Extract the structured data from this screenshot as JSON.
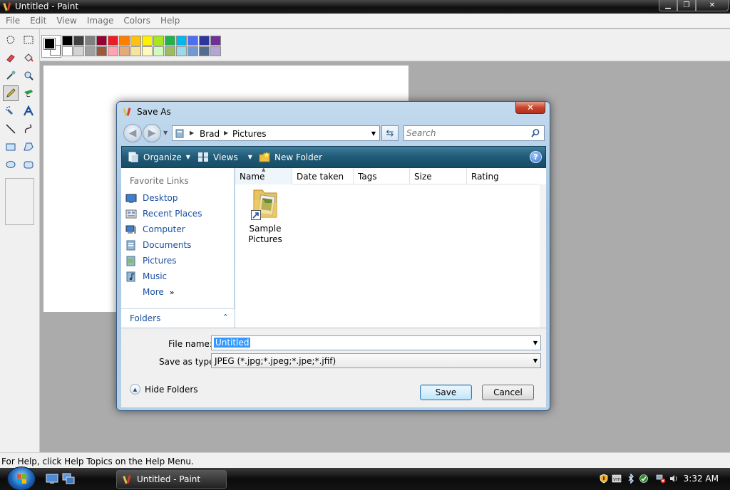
{
  "window": {
    "title": "Untitled - Paint"
  },
  "menubar": {
    "items": [
      "File",
      "Edit",
      "View",
      "Image",
      "Colors",
      "Help"
    ]
  },
  "palette": {
    "row1": [
      "#000000",
      "#404040",
      "#808080",
      "#990030",
      "#ed1c24",
      "#ff7e00",
      "#ffc20e",
      "#fff200",
      "#a8e61d",
      "#22b14c",
      "#00b7ef",
      "#4d6df3",
      "#2f3699",
      "#6f3198"
    ],
    "row2": [
      "#ffffff",
      "#d3d3d3",
      "#a0a0a0",
      "#9c5a3c",
      "#ffa3b1",
      "#e5aa7a",
      "#f5e49c",
      "#fff9bd",
      "#d3f9bc",
      "#9dbb61",
      "#99d9ea",
      "#709ad1",
      "#546d8e",
      "#b5a5d5"
    ]
  },
  "statusbar": {
    "text": "For Help, click Help Topics on the Help Menu."
  },
  "taskbar": {
    "task_label": "Untitled - Paint",
    "clock": "3:32 AM"
  },
  "dialog": {
    "title": "Save As",
    "close_glyph": "✕",
    "breadcrumb": [
      "Brad",
      "Pictures"
    ],
    "search_placeholder": "Search",
    "commands": {
      "organize": "Organize",
      "views": "Views",
      "new_folder": "New Folder"
    },
    "favorites_title": "Favorite Links",
    "favorites": [
      "Desktop",
      "Recent Places",
      "Computer",
      "Documents",
      "Pictures",
      "Music"
    ],
    "more_label": "More",
    "folders_label": "Folders",
    "columns": [
      "Name",
      "Date taken",
      "Tags",
      "Size",
      "Rating"
    ],
    "files": [
      {
        "label_line1": "Sample",
        "label_line2": "Pictures"
      }
    ],
    "file_name_label": "File name:",
    "file_name_value": "Untitled",
    "save_type_label": "Save as type:",
    "save_type_value": "JPEG (*.jpg;*.jpeg;*.jpe;*.jfif)",
    "hide_folders_label": "Hide Folders",
    "save_label": "Save",
    "cancel_label": "Cancel"
  }
}
